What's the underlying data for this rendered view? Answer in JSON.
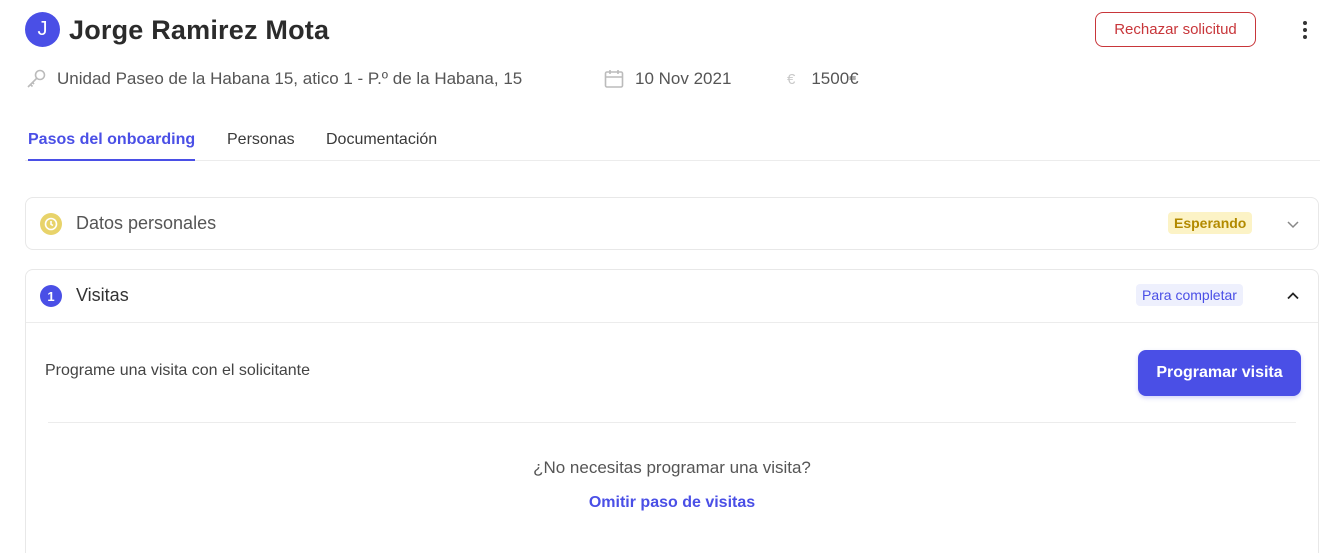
{
  "applicant": {
    "avatar_letter": "J",
    "name": "Jorge Ramirez Mota"
  },
  "actions": {
    "reject_label": "Rechazar solicitud",
    "more_icon": "vertical-dots-icon"
  },
  "meta": {
    "unit": "Unidad Paseo de la Habana 15, atico 1 - P.º de la Habana, 15",
    "unit_icon": "key-icon",
    "date": "10 Nov 2021",
    "date_icon": "calendar-icon",
    "price": "1500€",
    "price_icon": "euro-icon",
    "price_symbol": "€"
  },
  "tabs": [
    {
      "label": "Pasos del onboarding",
      "active": true
    },
    {
      "label": "Personas",
      "active": false
    },
    {
      "label": "Documentación",
      "active": false
    }
  ],
  "steps": [
    {
      "title": "Datos personales",
      "icon": "clock-icon",
      "status": "Esperando",
      "expanded": false
    },
    {
      "number": "1",
      "title": "Visitas",
      "status": "Para completar",
      "expanded": true,
      "body": {
        "prompt": "Programe una visita con el solicitante",
        "button_label": "Programar visita",
        "question": "¿No necesitas programar una visita?",
        "skip_link": "Omitir paso de visitas"
      }
    }
  ],
  "colors": {
    "accent": "#4a4fe6",
    "danger": "#c8363a",
    "waiting_badge_bg": "#fcf3c6",
    "waiting_badge_text": "#b28a00",
    "todo_badge_bg": "#eef0fd"
  }
}
